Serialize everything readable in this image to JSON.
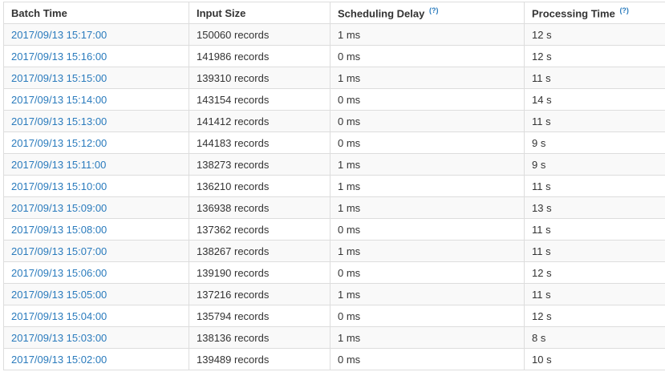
{
  "table": {
    "headers": {
      "batch_time": "Batch Time",
      "input_size": "Input Size",
      "scheduling_delay": "Scheduling Delay",
      "scheduling_delay_help": "(?)",
      "processing_time": "Processing Time",
      "processing_time_help": "(?)"
    },
    "rows": [
      {
        "batch_time": "2017/09/13 15:17:00",
        "input_size": "150060 records",
        "scheduling_delay": "1 ms",
        "processing_time": "12 s"
      },
      {
        "batch_time": "2017/09/13 15:16:00",
        "input_size": "141986 records",
        "scheduling_delay": "0 ms",
        "processing_time": "12 s"
      },
      {
        "batch_time": "2017/09/13 15:15:00",
        "input_size": "139310 records",
        "scheduling_delay": "1 ms",
        "processing_time": "11 s"
      },
      {
        "batch_time": "2017/09/13 15:14:00",
        "input_size": "143154 records",
        "scheduling_delay": "0 ms",
        "processing_time": "14 s"
      },
      {
        "batch_time": "2017/09/13 15:13:00",
        "input_size": "141412 records",
        "scheduling_delay": "0 ms",
        "processing_time": "11 s"
      },
      {
        "batch_time": "2017/09/13 15:12:00",
        "input_size": "144183 records",
        "scheduling_delay": "0 ms",
        "processing_time": "9 s"
      },
      {
        "batch_time": "2017/09/13 15:11:00",
        "input_size": "138273 records",
        "scheduling_delay": "1 ms",
        "processing_time": "9 s"
      },
      {
        "batch_time": "2017/09/13 15:10:00",
        "input_size": "136210 records",
        "scheduling_delay": "1 ms",
        "processing_time": "11 s"
      },
      {
        "batch_time": "2017/09/13 15:09:00",
        "input_size": "136938 records",
        "scheduling_delay": "1 ms",
        "processing_time": "13 s"
      },
      {
        "batch_time": "2017/09/13 15:08:00",
        "input_size": "137362 records",
        "scheduling_delay": "0 ms",
        "processing_time": "11 s"
      },
      {
        "batch_time": "2017/09/13 15:07:00",
        "input_size": "138267 records",
        "scheduling_delay": "1 ms",
        "processing_time": "11 s"
      },
      {
        "batch_time": "2017/09/13 15:06:00",
        "input_size": "139190 records",
        "scheduling_delay": "0 ms",
        "processing_time": "12 s"
      },
      {
        "batch_time": "2017/09/13 15:05:00",
        "input_size": "137216 records",
        "scheduling_delay": "1 ms",
        "processing_time": "11 s"
      },
      {
        "batch_time": "2017/09/13 15:04:00",
        "input_size": "135794 records",
        "scheduling_delay": "0 ms",
        "processing_time": "12 s"
      },
      {
        "batch_time": "2017/09/13 15:03:00",
        "input_size": "138136 records",
        "scheduling_delay": "1 ms",
        "processing_time": "8 s"
      },
      {
        "batch_time": "2017/09/13 15:02:00",
        "input_size": "139489 records",
        "scheduling_delay": "0 ms",
        "processing_time": "10 s"
      }
    ]
  },
  "colors": {
    "link": "#2a7bbd",
    "text": "#333333",
    "border": "#dddddd",
    "row_stripe": "#f9f9f9"
  }
}
